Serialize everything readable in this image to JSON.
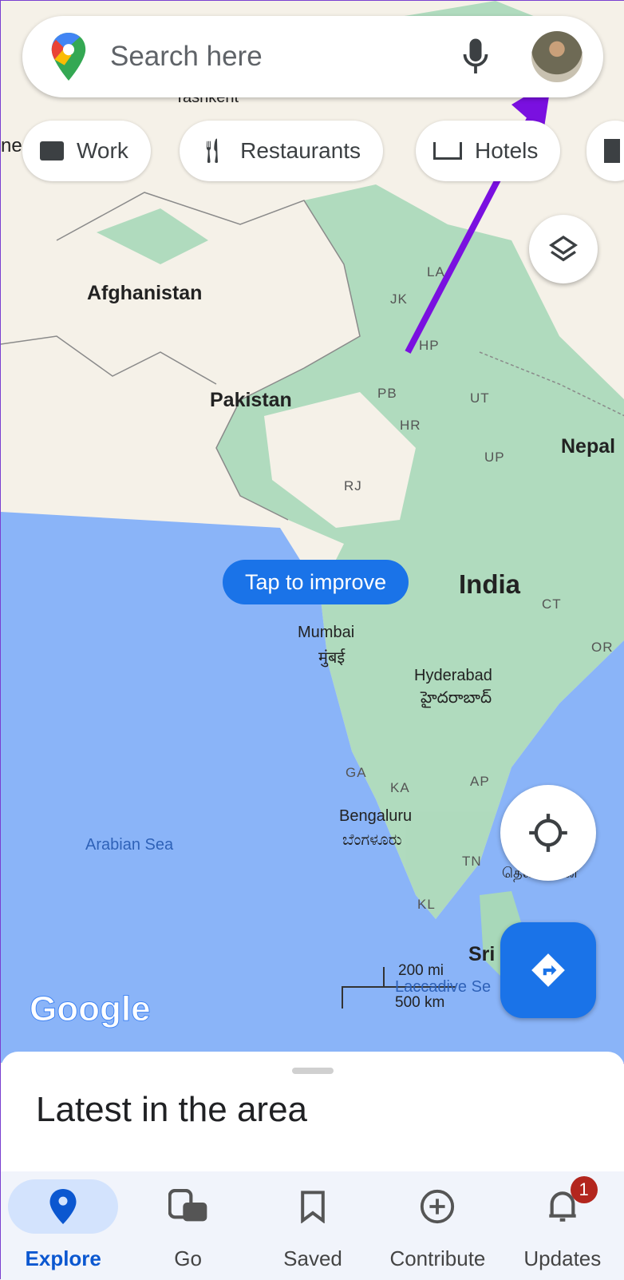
{
  "search": {
    "placeholder": "Search here",
    "icons": [
      "google-maps-pin-icon",
      "microphone-icon",
      "avatar"
    ]
  },
  "chips": [
    {
      "label": "Work",
      "icon": "briefcase-icon"
    },
    {
      "label": "Restaurants",
      "icon": "fork-knife-icon"
    },
    {
      "label": "Hotels",
      "icon": "bed-icon"
    },
    {
      "label": "",
      "icon": "gas-station-icon"
    }
  ],
  "map": {
    "countries": [
      "Afghanistan",
      "Pakistan",
      "India",
      "Nepal",
      "Sri"
    ],
    "cities": [
      "Tashkent",
      "Mumbai",
      "मुंबई",
      "Hyderabad",
      "హైదరాబాద్",
      "Bengaluru",
      "ಬೆಂಗಳೂರು",
      "ne"
    ],
    "states": [
      "LA",
      "JK",
      "HP",
      "PB",
      "UT",
      "HR",
      "UP",
      "RJ",
      "CT",
      "OR",
      "GA",
      "KA",
      "AP",
      "TN",
      "KL"
    ],
    "seas": [
      "Arabian Sea",
      "Laccadive Se"
    ],
    "tap_to_improve": "Tap to improve",
    "scale": {
      "mi": "200 mi",
      "km": "500 km"
    },
    "logo": "Google",
    "partial_tamil": "தெலங்கான",
    "colors": {
      "land": "#f5f1e8",
      "forest": "#a8d8b9",
      "sea": "#8ab4f8",
      "accent": "#1a73e8"
    }
  },
  "sheet": {
    "title": "Latest in the area"
  },
  "nav": [
    {
      "label": "Explore",
      "icon": "explore-pin-icon",
      "active": true
    },
    {
      "label": "Go",
      "icon": "transit-car-icon"
    },
    {
      "label": "Saved",
      "icon": "bookmark-icon"
    },
    {
      "label": "Contribute",
      "icon": "add-circle-icon"
    },
    {
      "label": "Updates",
      "icon": "bell-icon",
      "badge": "1"
    }
  ]
}
